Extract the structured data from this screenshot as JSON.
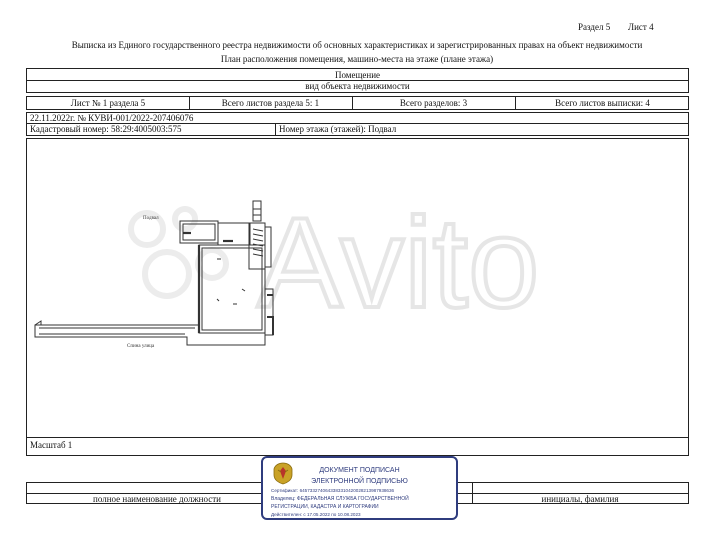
{
  "header": {
    "section": "Раздел 5",
    "sheet": "Лист 4",
    "title": "Выписка из Единого государственного реестра недвижимости об основных характеристиках и зарегистрированных правах на объект недвижимости",
    "subtitle": "План расположения помещения, машино-места на этаже (плане этажа)"
  },
  "table": {
    "object_type": "Помещение",
    "object_type_caption": "вид объекта недвижимости",
    "sheet_no": "Лист № 1 раздела 5",
    "total_sheets_section": "Всего листов раздела 5: 1",
    "total_sections": "Всего разделов: 3",
    "total_sheets_extract": "Всего листов выписки: 4",
    "date_number": "22.11.2022г. № КУВИ-001/2022-207406076",
    "cadastral": "Кадастровый номер: 58:29:4005003:575",
    "floor": "Номер этажа (этажей): Подвал"
  },
  "plan": {
    "label_floor": "Подвал",
    "label_street": "Спина улица",
    "watermark": "Avito"
  },
  "footer": {
    "scale": "Масштаб 1",
    "position_label": "полное наименование должности",
    "name_label": "инициалы, фамилия"
  },
  "stamp": {
    "line1": "ДОКУМЕНТ ПОДПИСАН",
    "line2": "ЭЛЕКТРОННОЙ ПОДПИСЬЮ",
    "cert": "Сертификат: 6457332740643383310420028213987938636",
    "owner": "Владелец: ФЕДЕРАЛЬНАЯ СЛУЖБА ГОСУДАРСТВЕННОЙ",
    "owner2": "РЕГИСТРАЦИИ, КАДАСТРА И КАРТОГРАФИИ",
    "valid": "Действителен: с 17.05.2022 по 10.08.2023"
  }
}
